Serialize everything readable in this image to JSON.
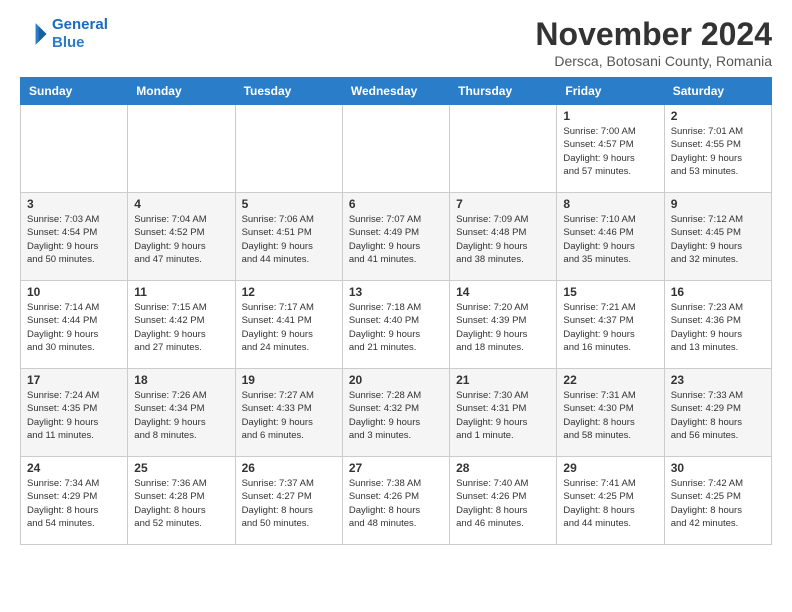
{
  "logo": {
    "line1": "General",
    "line2": "Blue"
  },
  "title": "November 2024",
  "subtitle": "Dersca, Botosani County, Romania",
  "days_of_week": [
    "Sunday",
    "Monday",
    "Tuesday",
    "Wednesday",
    "Thursday",
    "Friday",
    "Saturday"
  ],
  "weeks": [
    [
      {
        "day": "",
        "info": ""
      },
      {
        "day": "",
        "info": ""
      },
      {
        "day": "",
        "info": ""
      },
      {
        "day": "",
        "info": ""
      },
      {
        "day": "",
        "info": ""
      },
      {
        "day": "1",
        "info": "Sunrise: 7:00 AM\nSunset: 4:57 PM\nDaylight: 9 hours\nand 57 minutes."
      },
      {
        "day": "2",
        "info": "Sunrise: 7:01 AM\nSunset: 4:55 PM\nDaylight: 9 hours\nand 53 minutes."
      }
    ],
    [
      {
        "day": "3",
        "info": "Sunrise: 7:03 AM\nSunset: 4:54 PM\nDaylight: 9 hours\nand 50 minutes."
      },
      {
        "day": "4",
        "info": "Sunrise: 7:04 AM\nSunset: 4:52 PM\nDaylight: 9 hours\nand 47 minutes."
      },
      {
        "day": "5",
        "info": "Sunrise: 7:06 AM\nSunset: 4:51 PM\nDaylight: 9 hours\nand 44 minutes."
      },
      {
        "day": "6",
        "info": "Sunrise: 7:07 AM\nSunset: 4:49 PM\nDaylight: 9 hours\nand 41 minutes."
      },
      {
        "day": "7",
        "info": "Sunrise: 7:09 AM\nSunset: 4:48 PM\nDaylight: 9 hours\nand 38 minutes."
      },
      {
        "day": "8",
        "info": "Sunrise: 7:10 AM\nSunset: 4:46 PM\nDaylight: 9 hours\nand 35 minutes."
      },
      {
        "day": "9",
        "info": "Sunrise: 7:12 AM\nSunset: 4:45 PM\nDaylight: 9 hours\nand 32 minutes."
      }
    ],
    [
      {
        "day": "10",
        "info": "Sunrise: 7:14 AM\nSunset: 4:44 PM\nDaylight: 9 hours\nand 30 minutes."
      },
      {
        "day": "11",
        "info": "Sunrise: 7:15 AM\nSunset: 4:42 PM\nDaylight: 9 hours\nand 27 minutes."
      },
      {
        "day": "12",
        "info": "Sunrise: 7:17 AM\nSunset: 4:41 PM\nDaylight: 9 hours\nand 24 minutes."
      },
      {
        "day": "13",
        "info": "Sunrise: 7:18 AM\nSunset: 4:40 PM\nDaylight: 9 hours\nand 21 minutes."
      },
      {
        "day": "14",
        "info": "Sunrise: 7:20 AM\nSunset: 4:39 PM\nDaylight: 9 hours\nand 18 minutes."
      },
      {
        "day": "15",
        "info": "Sunrise: 7:21 AM\nSunset: 4:37 PM\nDaylight: 9 hours\nand 16 minutes."
      },
      {
        "day": "16",
        "info": "Sunrise: 7:23 AM\nSunset: 4:36 PM\nDaylight: 9 hours\nand 13 minutes."
      }
    ],
    [
      {
        "day": "17",
        "info": "Sunrise: 7:24 AM\nSunset: 4:35 PM\nDaylight: 9 hours\nand 11 minutes."
      },
      {
        "day": "18",
        "info": "Sunrise: 7:26 AM\nSunset: 4:34 PM\nDaylight: 9 hours\nand 8 minutes."
      },
      {
        "day": "19",
        "info": "Sunrise: 7:27 AM\nSunset: 4:33 PM\nDaylight: 9 hours\nand 6 minutes."
      },
      {
        "day": "20",
        "info": "Sunrise: 7:28 AM\nSunset: 4:32 PM\nDaylight: 9 hours\nand 3 minutes."
      },
      {
        "day": "21",
        "info": "Sunrise: 7:30 AM\nSunset: 4:31 PM\nDaylight: 9 hours\nand 1 minute."
      },
      {
        "day": "22",
        "info": "Sunrise: 7:31 AM\nSunset: 4:30 PM\nDaylight: 8 hours\nand 58 minutes."
      },
      {
        "day": "23",
        "info": "Sunrise: 7:33 AM\nSunset: 4:29 PM\nDaylight: 8 hours\nand 56 minutes."
      }
    ],
    [
      {
        "day": "24",
        "info": "Sunrise: 7:34 AM\nSunset: 4:29 PM\nDaylight: 8 hours\nand 54 minutes."
      },
      {
        "day": "25",
        "info": "Sunrise: 7:36 AM\nSunset: 4:28 PM\nDaylight: 8 hours\nand 52 minutes."
      },
      {
        "day": "26",
        "info": "Sunrise: 7:37 AM\nSunset: 4:27 PM\nDaylight: 8 hours\nand 50 minutes."
      },
      {
        "day": "27",
        "info": "Sunrise: 7:38 AM\nSunset: 4:26 PM\nDaylight: 8 hours\nand 48 minutes."
      },
      {
        "day": "28",
        "info": "Sunrise: 7:40 AM\nSunset: 4:26 PM\nDaylight: 8 hours\nand 46 minutes."
      },
      {
        "day": "29",
        "info": "Sunrise: 7:41 AM\nSunset: 4:25 PM\nDaylight: 8 hours\nand 44 minutes."
      },
      {
        "day": "30",
        "info": "Sunrise: 7:42 AM\nSunset: 4:25 PM\nDaylight: 8 hours\nand 42 minutes."
      }
    ]
  ]
}
